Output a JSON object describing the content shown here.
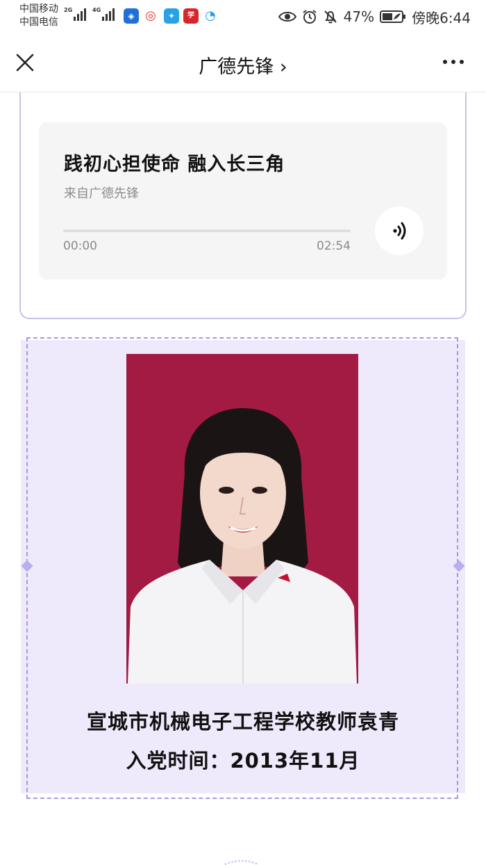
{
  "status_bar": {
    "carrier_1": "中国移动",
    "carrier_2": "中国电信",
    "network_1": "2G",
    "network_2": "4G",
    "battery": "47%",
    "time": "傍晚6:44"
  },
  "header": {
    "title": "广德先锋",
    "title_chevron": "›"
  },
  "audio": {
    "title": "践初心担使命 融入长三角",
    "source": "来自广德先锋",
    "current_time": "00:00",
    "total_time": "02:54",
    "progress": 0,
    "icon": "sound-wave-icon"
  },
  "profile": {
    "name_line": "宣城市机械电子工程学校教师袁青",
    "join_line": "入党时间：2013年11月"
  },
  "colors": {
    "accent_purple": "#c9c1ea",
    "panel_bg": "#efe9fc",
    "portrait_bg": "#a31a43"
  }
}
